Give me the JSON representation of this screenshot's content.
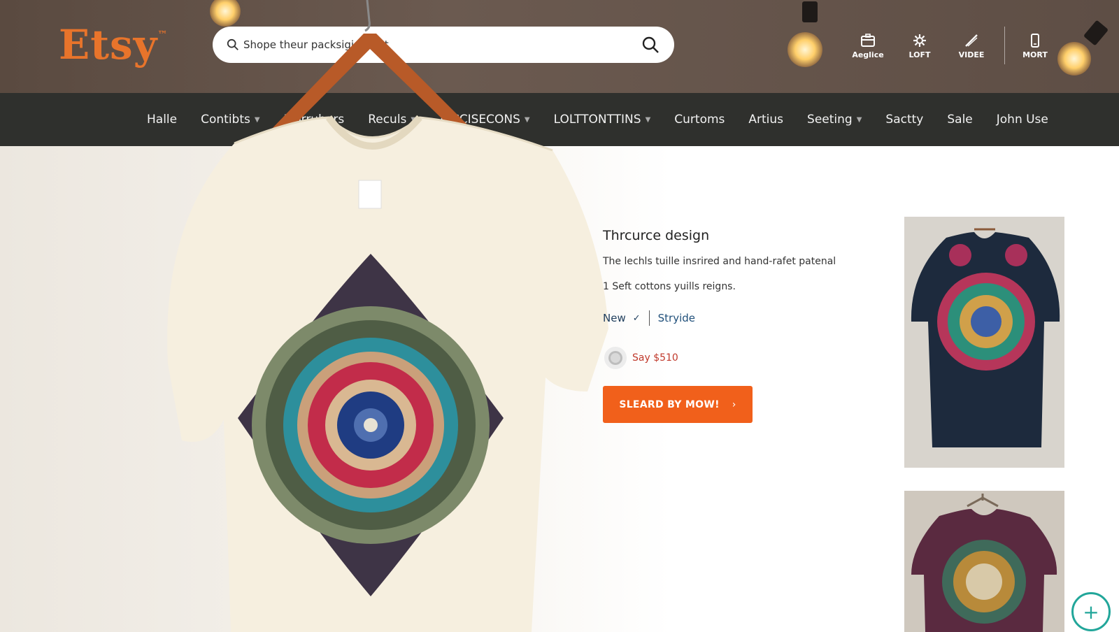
{
  "header": {
    "logo": "Etsy",
    "logo_mark": "™",
    "search": {
      "placeholder": "Shope theur packsigi csiont"
    },
    "icons": [
      {
        "label": "Aeglice",
        "icon": "shop-icon"
      },
      {
        "label": "LOFT",
        "icon": "gear-icon"
      },
      {
        "label": "VIDEE",
        "icon": "pen-icon"
      },
      {
        "label": "MORT",
        "icon": "phone-icon"
      }
    ]
  },
  "nav": {
    "items": [
      {
        "label": "Halle",
        "dropdown": false
      },
      {
        "label": "Contibts",
        "dropdown": true
      },
      {
        "label": "Morrubers",
        "dropdown": false
      },
      {
        "label": "Reculs",
        "dropdown": true
      },
      {
        "label": "EICCISECONS",
        "dropdown": true
      },
      {
        "label": "LOLTTONTTINS",
        "dropdown": true
      },
      {
        "label": "Curtoms",
        "dropdown": false
      },
      {
        "label": "Artius",
        "dropdown": false
      },
      {
        "label": "Seeting",
        "dropdown": true
      },
      {
        "label": "Sactty",
        "dropdown": false
      },
      {
        "label": "Sale",
        "dropdown": false
      },
      {
        "label": "John Use",
        "dropdown": false
      }
    ]
  },
  "product": {
    "title": "Thrcurce design",
    "description": "The lechls tuille insrired and hand-rafet patenal",
    "subtitle": "1 Seft cottons yuills reigns.",
    "option_new": "New",
    "option_check": "✓",
    "option_style": "Stryide",
    "price": "Say $510",
    "cta": "SLEARD BY MOW!",
    "cta_arrow": "›"
  },
  "fab": {
    "label": "+"
  },
  "colors": {
    "brand": "#e8742b",
    "cta": "#f1601b",
    "nav_bg": "#2f302d",
    "header_bg": "#5e4e45",
    "price": "#c0392b",
    "fab": "#22a69a"
  }
}
